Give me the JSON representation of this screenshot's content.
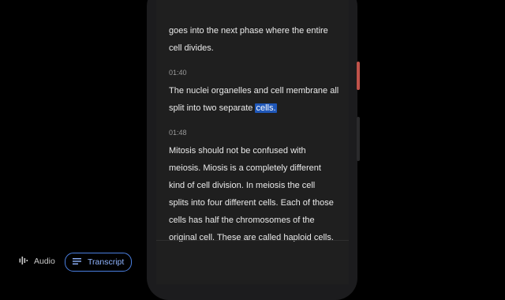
{
  "transcript": {
    "segments": [
      {
        "lines": [
          "goes into the next phase where the entire",
          "cell divides."
        ]
      },
      {
        "timestamp": "01:40",
        "lines": [
          "The nuclei organelles and cell membrane all",
          "split into two separate "
        ],
        "highlight": "cells."
      },
      {
        "timestamp": "01:48",
        "lines": [
          "Mitosis should not be confused with",
          "meiosis. Miosis is a completely different",
          "kind of cell division. In meiosis the cell",
          "splits into four different cells. Each of those",
          "cells has half the chromosomes of the",
          "original cell. These are called haploid cells."
        ]
      }
    ]
  },
  "tabs": {
    "audio_label": "Audio",
    "audio_icon": "waveform-icon",
    "transcript_label": "Transcript",
    "transcript_icon": "list-lines-icon"
  },
  "colors": {
    "background": "#000000",
    "screen": "#1f1f1f",
    "highlight": "#1f57b8",
    "accent": "#4a7fe0"
  }
}
